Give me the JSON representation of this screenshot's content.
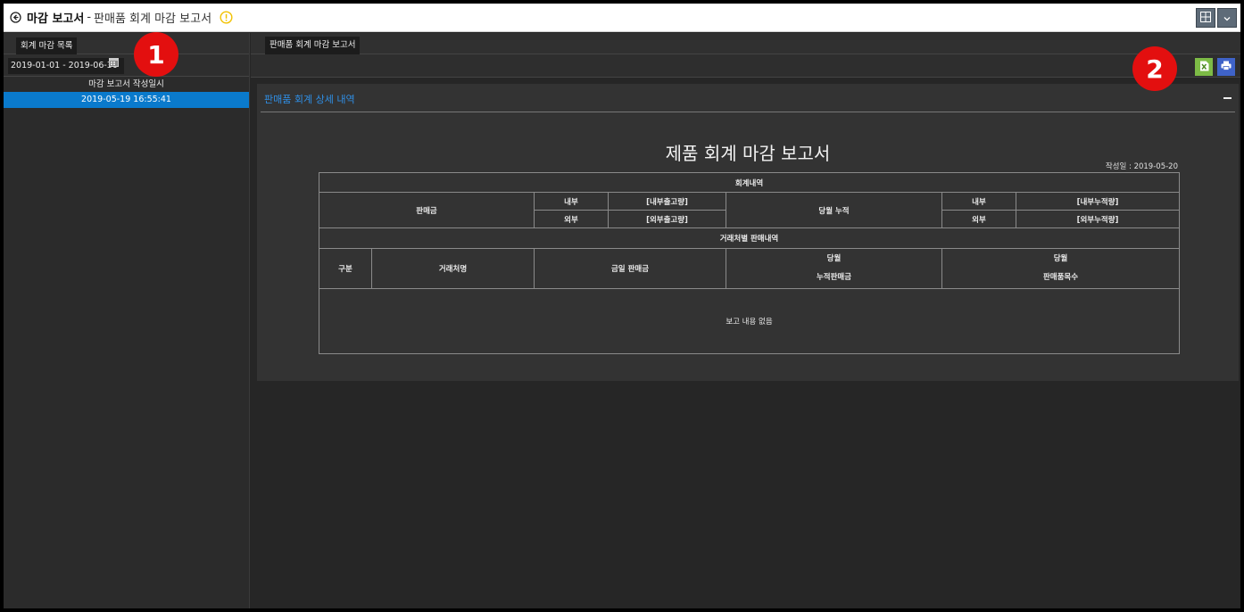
{
  "titlebar": {
    "title": "마감 보고서",
    "separator": "-",
    "subtitle": "판매품 회계 마감 보고서"
  },
  "left_panel": {
    "tab_label": "회계 마감 목록",
    "date_range": "2019-01-01 - 2019-06-30",
    "list_header": "마감 보고서 작성일시",
    "items": [
      "2019-05-19 16:55:41"
    ]
  },
  "badges": {
    "one": "1",
    "two": "2"
  },
  "right_panel": {
    "tab_label": "판매품 회계 마감 보고서",
    "section_title": "판매품 회계 상세 내역"
  },
  "report": {
    "title": "제품 회계 마감 보고서",
    "date_label": "작성일 : 2019-05-20",
    "section1": "회계내역",
    "sales_amount": "판매금",
    "internal": "내부",
    "external": "외부",
    "internal_shipped": "[내부출고량]",
    "external_shipped": "[외부출고량]",
    "monthly_cumulative": "당월 누적",
    "internal_cumulative": "[내부누적량]",
    "external_cumulative": "[외부누적량]",
    "section2": "거래처별 판매내역",
    "columns": {
      "category": "구분",
      "client_name": "거래처명",
      "today_sales": "금일 판매금",
      "month1": "당월",
      "cumulative_sales": "누적판매금",
      "month2": "당월",
      "items_sold": "판매품목수"
    },
    "empty_message": "보고 내용 없음"
  },
  "icons": {
    "back": "back-arrow-icon",
    "info": "info-warning-icon",
    "grid": "grid-view-icon",
    "dropdown": "chevron-down-icon",
    "calendar": "calendar-icon",
    "excel": "excel-export-icon",
    "print": "print-icon",
    "collapse": "collapse-minus-icon"
  },
  "colors": {
    "accent_blue": "#0a7acc",
    "section_title_blue": "#2f8fe6",
    "badge_red": "#e30f0f",
    "excel_green": "#7dbb46",
    "print_blue": "#3f63c8"
  }
}
